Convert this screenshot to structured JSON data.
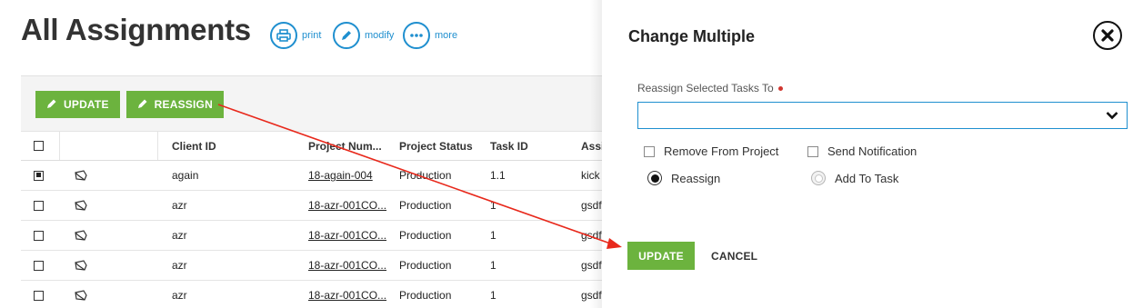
{
  "page": {
    "title": "All Assignments",
    "actions": [
      {
        "label": "print",
        "icon": "printer-icon"
      },
      {
        "label": "modify",
        "icon": "pencil-icon"
      },
      {
        "label": "more",
        "icon": "ellipsis-icon"
      }
    ]
  },
  "toolbar": {
    "update_label": "UPDATE",
    "reassign_label": "REASSIGN"
  },
  "table": {
    "columns": [
      "Client ID",
      "Project Num...",
      "Project Status",
      "Task ID",
      "Assi"
    ],
    "rows": [
      {
        "selected": true,
        "client": "again",
        "project": "18-again-004",
        "status": "Production",
        "task": "1.1",
        "assignee": "kick"
      },
      {
        "selected": false,
        "client": "azr",
        "project": "18-azr-001CO...",
        "status": "Production",
        "task": "1",
        "assignee": "gsdf"
      },
      {
        "selected": false,
        "client": "azr",
        "project": "18-azr-001CO...",
        "status": "Production",
        "task": "1",
        "assignee": "gsdf"
      },
      {
        "selected": false,
        "client": "azr",
        "project": "18-azr-001CO...",
        "status": "Production",
        "task": "1",
        "assignee": "gsdf"
      },
      {
        "selected": false,
        "client": "azr",
        "project": "18-azr-001CO...",
        "status": "Production",
        "task": "1",
        "assignee": "gsdf"
      }
    ]
  },
  "dialog": {
    "title": "Change Multiple",
    "field_label": "Reassign Selected Tasks To",
    "select_value": "",
    "options": {
      "remove_from_project": "Remove From Project",
      "send_notification": "Send Notification",
      "reassign": "Reassign",
      "add_to_task": "Add To Task"
    },
    "reassign_selected": true,
    "update_label": "UPDATE",
    "cancel_label": "CANCEL"
  },
  "colors": {
    "accent_green": "#6cb33e",
    "accent_blue": "#1f8fcf",
    "annotation_red": "#e8291c",
    "required_dot": "#d0362f"
  }
}
